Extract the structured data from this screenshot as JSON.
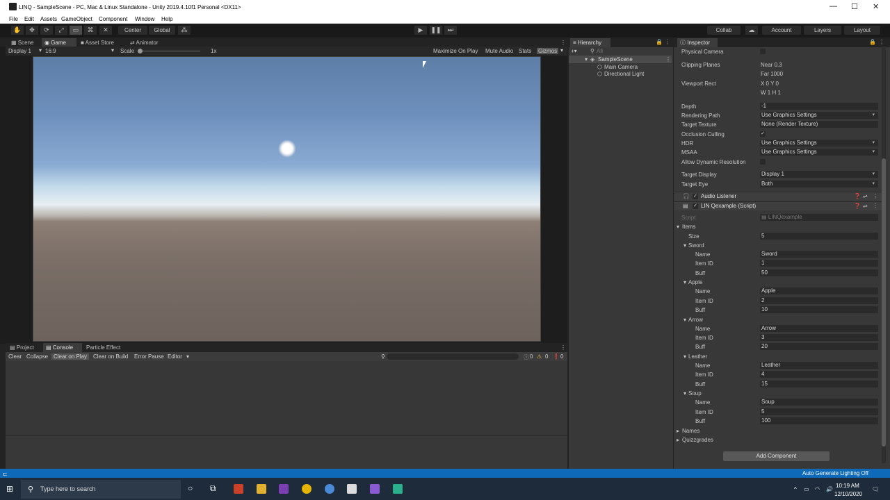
{
  "window": {
    "title": "LINQ - SampleScene - PC, Mac & Linux Standalone - Unity 2019.4.10f1 Personal <DX11>"
  },
  "menu": [
    "File",
    "Edit",
    "Assets",
    "GameObject",
    "Component",
    "Window",
    "Help"
  ],
  "toolbar": {
    "center": "Center",
    "global": "Global",
    "collab": "Collab",
    "account": "Account",
    "layers": "Layers",
    "layout": "Layout"
  },
  "tabs": {
    "scene": "Scene",
    "game": "Game",
    "asset_store": "Asset Store",
    "animator": "Animator",
    "hierarchy": "Hierarchy",
    "inspector": "Inspector",
    "project": "Project",
    "console": "Console",
    "particle": "Particle Effect"
  },
  "game": {
    "display": "Display 1",
    "aspect": "16:9",
    "scale_label": "Scale",
    "scale_value": "1x",
    "maximize": "Maximize On Play",
    "mute": "Mute Audio",
    "stats": "Stats",
    "gizmos": "Gizmos"
  },
  "console": {
    "clear": "Clear",
    "collapse": "Collapse",
    "clear_on_play": "Clear on Play",
    "clear_on_build": "Clear on Build",
    "error_pause": "Error Pause",
    "editor": "Editor",
    "c1": "0",
    "c2": "0",
    "c3": "0"
  },
  "hierarchy": {
    "search": "All",
    "scene": "SampleScene",
    "items": [
      "Main Camera",
      "Directional Light"
    ]
  },
  "inspector": {
    "camera": [
      {
        "label": "Physical Camera",
        "type": "check",
        "value": ""
      },
      {
        "label": "Clipping Planes",
        "type": "text",
        "value": "Near   0.3"
      },
      {
        "label": "",
        "type": "text",
        "value": "Far   1000"
      },
      {
        "label": "Viewport Rect",
        "type": "text",
        "value": "X 0                  Y 0"
      },
      {
        "label": "",
        "type": "text",
        "value": "W 1                  H 1"
      },
      {
        "label": "Depth",
        "type": "field",
        "value": "-1"
      },
      {
        "label": "Rendering Path",
        "type": "dd",
        "value": "Use Graphics Settings"
      },
      {
        "label": "Target Texture",
        "type": "field",
        "value": "None (Render Texture)"
      },
      {
        "label": "Occlusion Culling",
        "type": "check",
        "value": "✓"
      },
      {
        "label": "HDR",
        "type": "dd",
        "value": "Use Graphics Settings"
      },
      {
        "label": "MSAA",
        "type": "dd",
        "value": "Use Graphics Settings"
      },
      {
        "label": "Allow Dynamic Resolution",
        "type": "check",
        "value": ""
      },
      {
        "label": "Target Display",
        "type": "dd",
        "value": "Display 1"
      },
      {
        "label": "Target Eye",
        "type": "dd",
        "value": "Both"
      }
    ],
    "audio_listener": "Audio Listener",
    "script_comp": "LIN Qexample (Script)",
    "script_label": "Script",
    "script_value": "LINQexample",
    "items_label": "Items",
    "size_label": "Size",
    "size_value": "5",
    "items": [
      {
        "title": "Sword",
        "name": "Sword",
        "id": "1",
        "buff": "50"
      },
      {
        "title": "Apple",
        "name": "Apple",
        "id": "2",
        "buff": "10"
      },
      {
        "title": "Arrow",
        "name": "Arrow",
        "id": "3",
        "buff": "20"
      },
      {
        "title": "Leather",
        "name": "Leather",
        "id": "4",
        "buff": "15"
      },
      {
        "title": "Soup",
        "name": "Soup",
        "id": "5",
        "buff": "100"
      }
    ],
    "field_labels": {
      "name": "Name",
      "id": "Item ID",
      "buff": "Buff"
    },
    "names": "Names",
    "quiz": "Quizzgrades",
    "add_component": "Add Component"
  },
  "status": {
    "right": "Auto Generate Lighting Off"
  },
  "taskbar": {
    "search": "Type here to search",
    "time": "10:19 AM",
    "date": "12/10/2020"
  }
}
